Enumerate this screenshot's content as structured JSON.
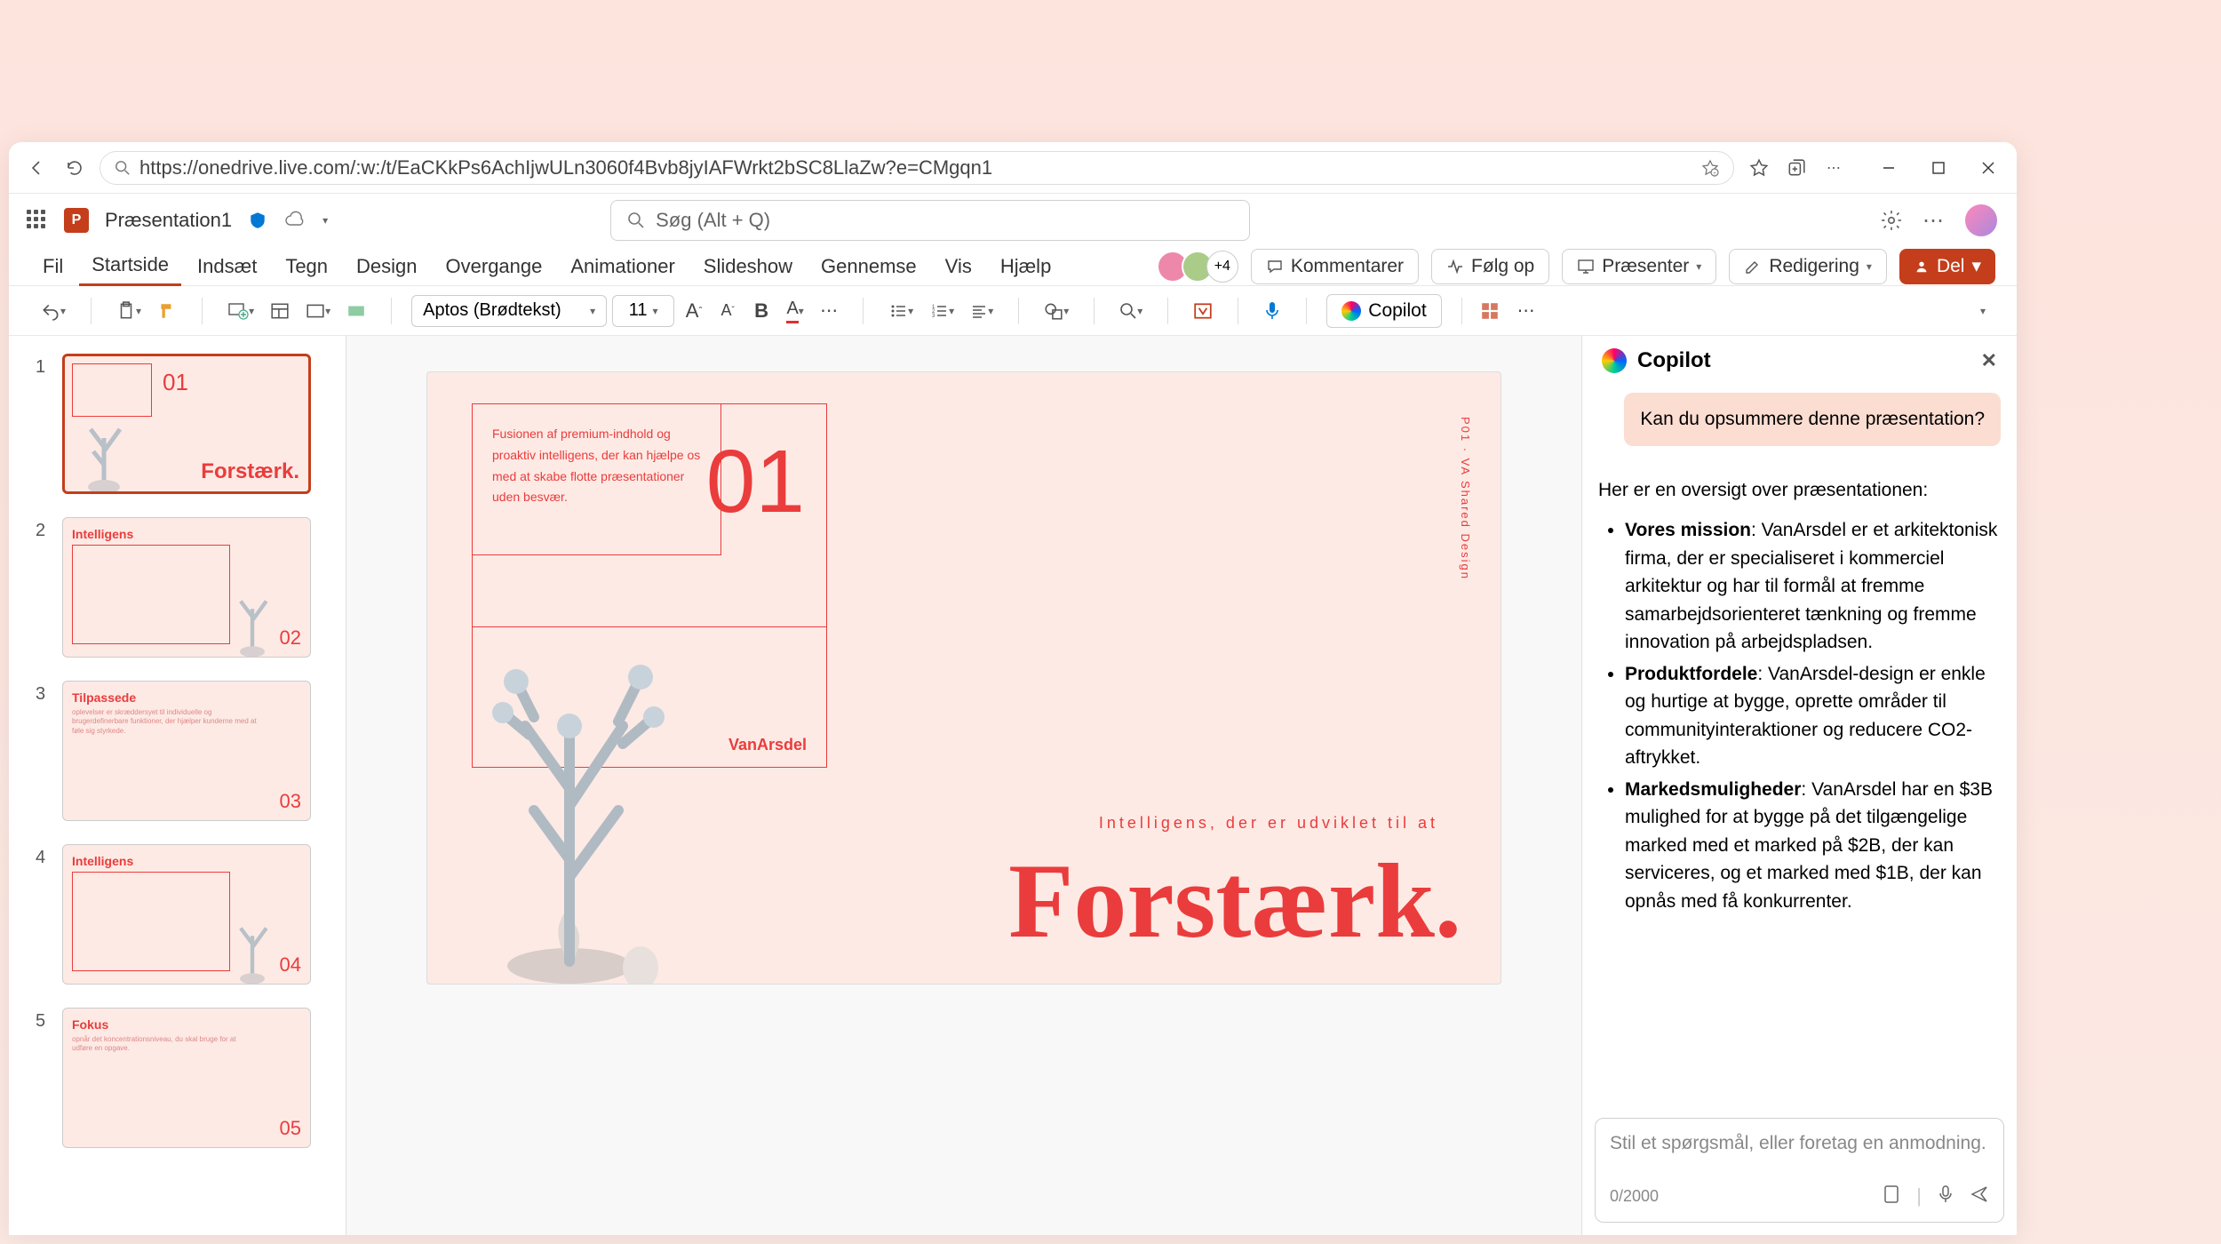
{
  "browser": {
    "url": "https://onedrive.live.com/:w:/t/EaCKkPs6AchIjwULn3060f4Bvb8jyIAFWrkt2bSC8LlaZw?e=CMgqn1"
  },
  "app": {
    "doc_title": "Præsentation1",
    "search_placeholder": "Søg (Alt + Q)"
  },
  "tabs": {
    "fil": "Fil",
    "startside": "Startside",
    "indsaet": "Indsæt",
    "tegn": "Tegn",
    "design": "Design",
    "overgange": "Overgange",
    "animationer": "Animationer",
    "slideshow": "Slideshow",
    "gennemse": "Gennemse",
    "vis": "Vis",
    "hjaelp": "Hjælp"
  },
  "ribbon_right": {
    "extra_count": "+4",
    "kommentarer": "Kommentarer",
    "foelg_op": "Følg op",
    "praesenter": "Præsenter",
    "redigering": "Redigering",
    "del": "Del"
  },
  "toolbar": {
    "font_name": "Aptos (Brødtekst)",
    "font_size": "11",
    "bold": "B",
    "font_color_letter": "A",
    "copilot": "Copilot"
  },
  "thumbs": [
    {
      "n": "1",
      "num": "01",
      "headline": "Forstærk."
    },
    {
      "n": "2",
      "num": "02",
      "title": "Intelligens"
    },
    {
      "n": "3",
      "num": "03",
      "title": "Tilpassede",
      "body": "oplevelser er skræddersyet til individuelle og brugerdefinerbare funktioner, der hjælper kunderne med at føle sig styrkede."
    },
    {
      "n": "4",
      "num": "04",
      "title": "Intelligens"
    },
    {
      "n": "5",
      "num": "05",
      "title": "Fokus",
      "body": "opnår det koncentrationsniveau, du skal bruge for at udføre en opgave."
    }
  ],
  "slide": {
    "box_text": "Fusionen af premium-indhold og proaktiv intelligens, der kan hjælpe os med at skabe flotte præsentationer uden besvær.",
    "number": "01",
    "brand": "VanArsdel",
    "side_text": "P01 · VA Shared Design",
    "subtitle": "Intelligens, der er udviklet til at",
    "headline": "Forstærk."
  },
  "copilot": {
    "title": "Copilot",
    "user_msg": "Kan du opsummere denne præsentation?",
    "intro": "Her er en oversigt over præsentationen:",
    "b1_label": "Vores mission",
    "b1_text": ": VanArsdel er et arkitektonisk firma, der er specialiseret i kommerciel arkitektur og har til formål at fremme samarbejdsorienteret tænkning og fremme innovation på arbejdspladsen.",
    "b2_label": "Produktfordele",
    "b2_text": ": VanArsdel-design er enkle og hurtige at bygge, oprette områder til communityinteraktioner og reducere CO2-aftrykket.",
    "b3_label": "Markedsmuligheder",
    "b3_text": ": VanArsdel har en $3B mulighed for at bygge på det tilgængelige marked med et marked på $2B, der kan serviceres, og et marked med $1B, der kan opnås med få konkurrenter.",
    "input_placeholder": "Stil et spørgsmål, eller foretag en anmodning.",
    "counter": "0/2000"
  }
}
